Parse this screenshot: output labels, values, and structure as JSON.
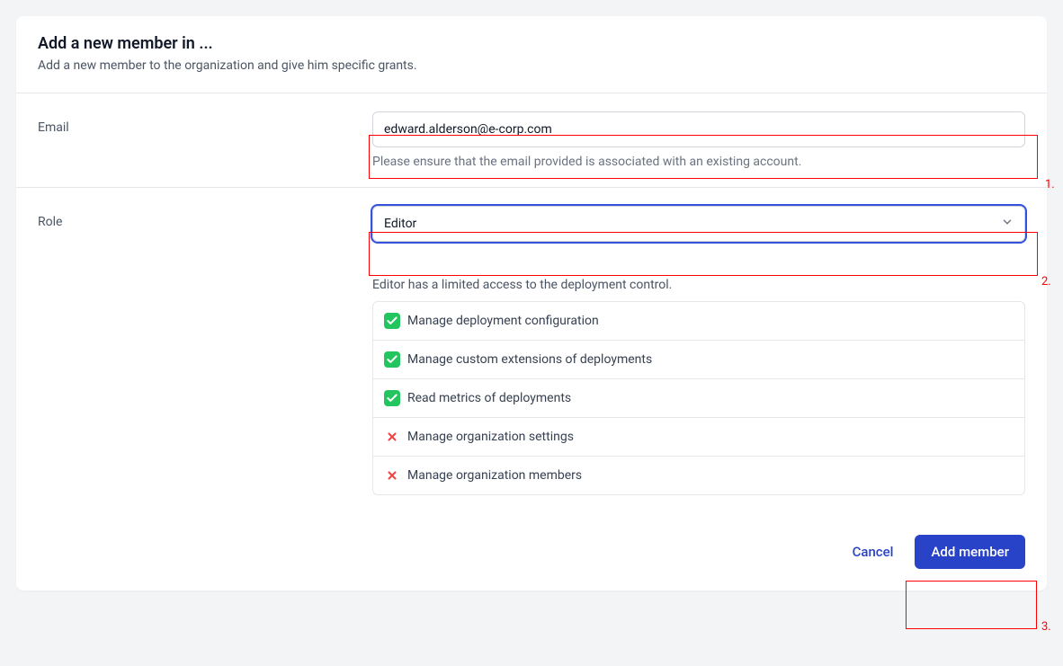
{
  "header": {
    "title": "Add a new member in ...",
    "subtitle": "Add a new member to the organization and give him specific grants."
  },
  "email": {
    "label": "Email",
    "value": "edward.alderson@e-corp.com",
    "help": "Please ensure that the email provided is associated with an existing account."
  },
  "role": {
    "label": "Role",
    "selected": "Editor"
  },
  "permissions": {
    "description": "Editor has a limited access to the deployment control.",
    "items": [
      {
        "label": "Manage deployment configuration",
        "allowed": true
      },
      {
        "label": "Manage custom extensions of deployments",
        "allowed": true
      },
      {
        "label": "Read metrics of deployments",
        "allowed": true
      },
      {
        "label": "Manage organization settings",
        "allowed": false
      },
      {
        "label": "Manage organization members",
        "allowed": false
      }
    ]
  },
  "footer": {
    "cancel": "Cancel",
    "submit": "Add member"
  },
  "annotations": {
    "one": "1.",
    "two": "2.",
    "three": "3."
  }
}
